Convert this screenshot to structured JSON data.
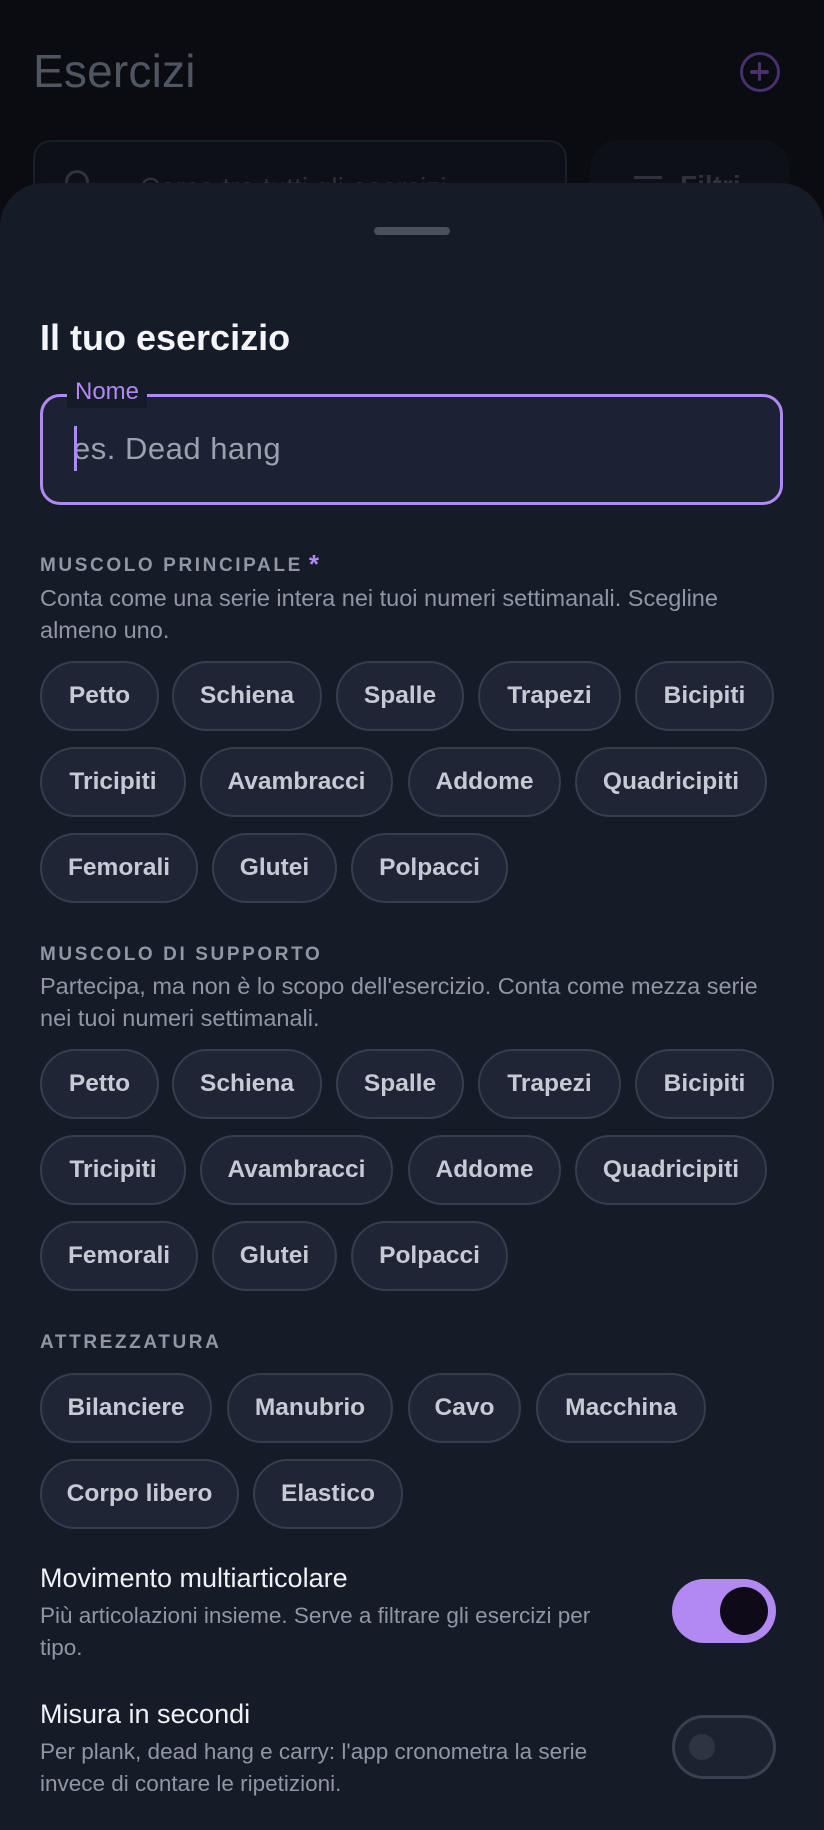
{
  "background": {
    "title": "Esercizi",
    "search_placeholder": "Cerca tra tutti gli esercizi",
    "filter_label": "Filtri"
  },
  "sheet": {
    "title": "Il tuo esercizio",
    "name_field": {
      "label": "Nome",
      "placeholder": "es. Dead hang",
      "value": ""
    },
    "primary_muscle": {
      "heading": "MUSCOLO PRINCIPALE",
      "required_mark": "*",
      "description": "Conta come una serie intera nei tuoi numeri settimanali. Scegline almeno uno.",
      "options": [
        "Petto",
        "Schiena",
        "Spalle",
        "Trapezi",
        "Bicipiti",
        "Tricipiti",
        "Avambracci",
        "Addome",
        "Quadricipiti",
        "Femorali",
        "Glutei",
        "Polpacci"
      ]
    },
    "support_muscle": {
      "heading": "MUSCOLO DI SUPPORTO",
      "description": "Partecipa, ma non è lo scopo dell'esercizio. Conta come mezza serie nei tuoi numeri settimanali.",
      "options": [
        "Petto",
        "Schiena",
        "Spalle",
        "Trapezi",
        "Bicipiti",
        "Tricipiti",
        "Avambracci",
        "Addome",
        "Quadricipiti",
        "Femorali",
        "Glutei",
        "Polpacci"
      ]
    },
    "equipment": {
      "heading": "ATTREZZATURA",
      "options": [
        "Bilanciere",
        "Manubrio",
        "Cavo",
        "Macchina",
        "Corpo libero",
        "Elastico"
      ]
    },
    "compound": {
      "title": "Movimento multiarticolare",
      "description": "Più articolazioni insieme. Serve a filtrare gli esercizi per tipo.",
      "enabled": true
    },
    "timed": {
      "title": "Misura in secondi",
      "description": "Per plank, dead hang e carry: l'app cronometra la serie invece di contare le ripetizioni.",
      "enabled": false
    }
  },
  "colors": {
    "accent": "#b288f2",
    "sheet_bg": "#161b28",
    "chip_bg": "#1f2534"
  }
}
